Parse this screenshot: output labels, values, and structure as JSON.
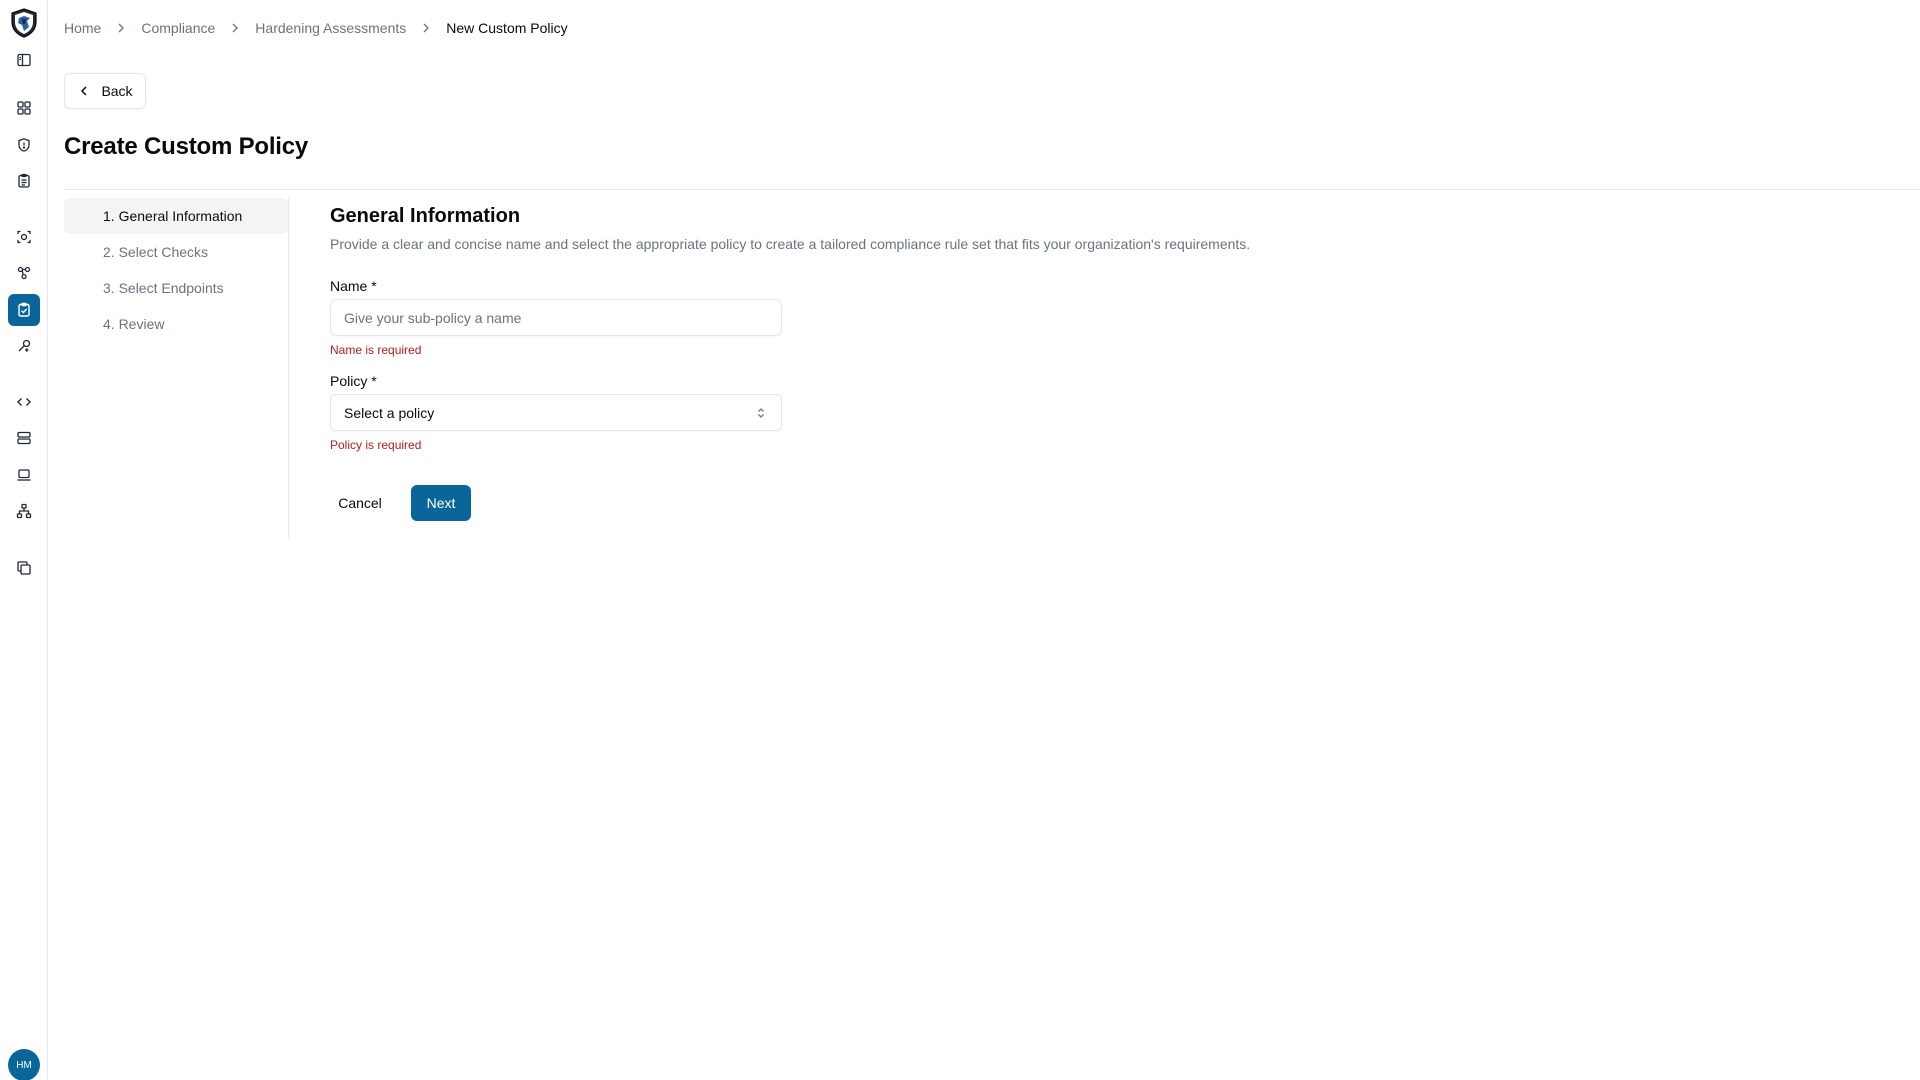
{
  "theme": {
    "accent": "#0a6699",
    "error": "#b91c1c",
    "muted_text": "#6b7280"
  },
  "sidebar": {
    "items": [
      {
        "icon": "panel-toggle-icon"
      },
      {
        "icon": "dashboard-icon"
      },
      {
        "icon": "shield-icon"
      },
      {
        "icon": "clipboard-list-icon"
      },
      {
        "icon": "scan-icon"
      },
      {
        "icon": "nodes-icon"
      },
      {
        "icon": "clipboard-check-icon",
        "active": true
      },
      {
        "icon": "tools-icon"
      },
      {
        "icon": "code-icon"
      },
      {
        "icon": "server-icon"
      },
      {
        "icon": "laptop-icon"
      },
      {
        "icon": "network-icon"
      },
      {
        "icon": "copy-icon"
      }
    ],
    "avatar_initials": "HM"
  },
  "breadcrumb": {
    "items": [
      "Home",
      "Compliance",
      "Hardening Assessments"
    ],
    "current": "New Custom Policy"
  },
  "back_label": "Back",
  "page_title": "Create Custom Policy",
  "steps": [
    {
      "label": "1. General Information",
      "active": true
    },
    {
      "label": "2. Select Checks"
    },
    {
      "label": "3. Select Endpoints"
    },
    {
      "label": "4. Review"
    }
  ],
  "form": {
    "title": "General Information",
    "description": "Provide a clear and concise name and select the appropriate policy to create a tailored compliance rule set that fits your organization's requirements.",
    "name_label": "Name *",
    "name_placeholder": "Give your sub-policy a name",
    "name_value": "",
    "name_error": "Name is required",
    "policy_label": "Policy *",
    "policy_placeholder": "Select a policy",
    "policy_error": "Policy is required",
    "cancel_label": "Cancel",
    "next_label": "Next"
  }
}
